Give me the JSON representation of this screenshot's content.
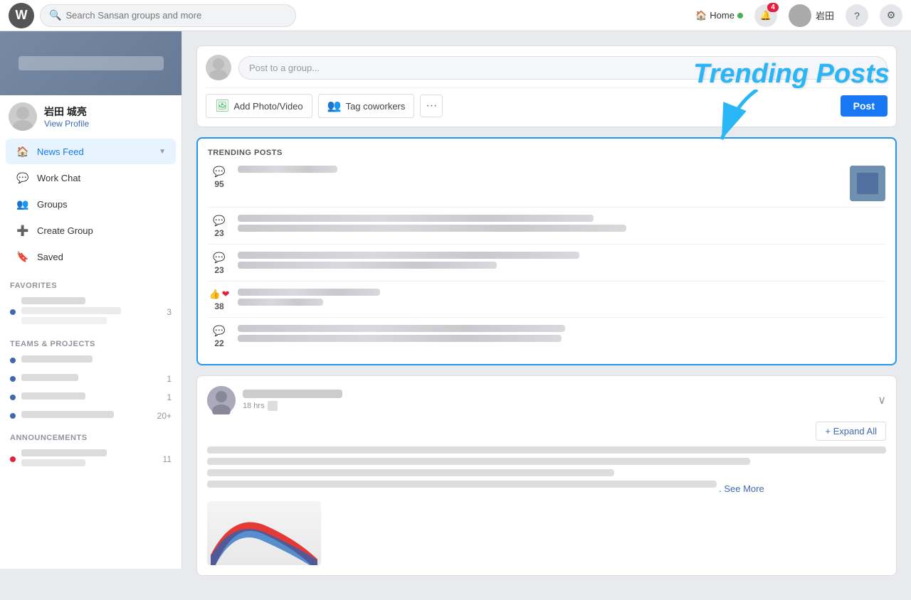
{
  "app": {
    "logo_char": "W",
    "search_placeholder": "Search Sansan groups and more"
  },
  "topnav": {
    "home_label": "Home",
    "notification_count": "4",
    "user_name": "岩田",
    "gear_icon": "⚙",
    "question_icon": "?",
    "bell_icon": "🔔"
  },
  "sidebar": {
    "cover_alt": "Cover photo",
    "user_display_name": "岩田 城亮",
    "view_profile_label": "View Profile",
    "nav_items": [
      {
        "id": "news-feed",
        "label": "News Feed",
        "icon": "🏠",
        "active": true
      },
      {
        "id": "work-chat",
        "label": "Work Chat",
        "icon": "💬",
        "active": false
      },
      {
        "id": "groups",
        "label": "Groups",
        "icon": "👥",
        "active": false
      },
      {
        "id": "create-group",
        "label": "Create Group",
        "icon": "➕",
        "active": false
      },
      {
        "id": "saved",
        "label": "Saved",
        "icon": "🔖",
        "active": false
      }
    ],
    "favorites_title": "FAVORITES",
    "teams_projects_title": "TEAMS & PROJECTS",
    "announcements_title": "ANNOUNCEMENTS",
    "fav_count": "3",
    "team_items": [
      {
        "count": ""
      },
      {
        "count": "1"
      },
      {
        "count": "1"
      },
      {
        "count": "20+"
      }
    ],
    "ann_count": "11"
  },
  "post_box": {
    "placeholder": "Post to a group...",
    "add_photo_label": "Add Photo/Video",
    "tag_coworkers_label": "Tag coworkers",
    "post_button_label": "Post"
  },
  "trending": {
    "section_label": "TRENDING POSTS",
    "annotation_text": "Trending Posts",
    "rows": [
      {
        "icon": "💬",
        "count": "95",
        "has_thumb": true
      },
      {
        "icon": "💬",
        "count": "23",
        "has_thumb": false
      },
      {
        "icon": "💬",
        "count": "23",
        "has_thumb": false
      },
      {
        "icon": "❤",
        "count": "38",
        "has_reactions": true,
        "has_thumb": false
      },
      {
        "icon": "💬",
        "count": "22",
        "has_thumb": false
      }
    ]
  },
  "feed_post": {
    "time_label": "18 hrs",
    "expand_all_label": "+ Expand All",
    "see_more_label": ". See More",
    "collapse_icon": "∨"
  }
}
